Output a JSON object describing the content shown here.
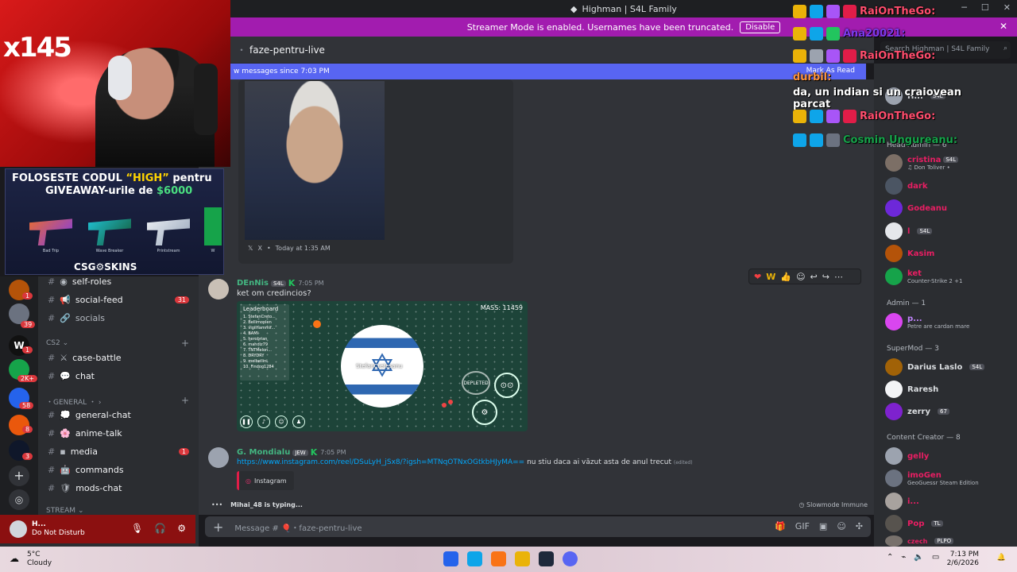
{
  "window": {
    "title": "Highman | S4L Family",
    "streamer_notice": "Streamer Mode is enabled. Usernames have been truncated.",
    "disable_label": "Disable"
  },
  "channel": {
    "name": "faze-pentru-live",
    "search_placeholder": "Search Highman | S4L Family",
    "new_messages": "w messages since 7:03 PM",
    "mark_as_read": "Mark As Read"
  },
  "messages": [
    {
      "embed_source": "X",
      "embed_time": "Today at 1:35 AM"
    },
    {
      "author": "DEnNis",
      "tag": "S4L",
      "time": "7:05 PM",
      "text": "ket om credincios?",
      "game": {
        "leaderboard_title": "Leaderboard",
        "leaderboard": [
          "1. StefanCreto...",
          "2. Bellimoplen",
          "3. vigilhammif...",
          "4. BAMI",
          "5. herobrian",
          "6. mahdiz79",
          "7. TNTMelon...",
          "8. DRYDRY",
          "9. melbellini",
          "10. Findog1284"
        ],
        "mass": "MASS: 11459",
        "player_label": "StefanCretesanu",
        "depleted": "DEPLETED"
      }
    },
    {
      "author": "G. Mondialu",
      "tag": "JEW",
      "time": "7:05 PM",
      "link": "https://www.instagram.com/reel/DSuLyH_jSx8/?igsh=MTNqOTNxOGtkbHJyMA==",
      "text": "nu stiu daca ai văzut asta de anul trecut",
      "edited": "(edited)",
      "embed": "Instagram"
    }
  ],
  "reactions": [
    "❤",
    "W",
    "👍",
    "☺",
    "↩",
    "↪",
    "⋯"
  ],
  "typing": "Mihai_48 is typing...",
  "slowmode": "Slowmode Immune",
  "composer_placeholder": "Message # 🎈・faze-pentru-live",
  "sidebar": {
    "channels": [
      {
        "name": "self-roles",
        "badge": ""
      },
      {
        "name": "social-feed",
        "badge": "31"
      },
      {
        "name": "socials",
        "badge": ""
      }
    ],
    "cat_cs2": "CS2",
    "cs2_channels": [
      {
        "name": "case-battle",
        "badge": ""
      },
      {
        "name": "chat",
        "badge": ""
      }
    ],
    "cat_general": "GENERAL",
    "general_channels": [
      {
        "name": "general-chat",
        "badge": ""
      },
      {
        "name": "anime-talk",
        "badge": ""
      },
      {
        "name": "media",
        "badge": "1"
      },
      {
        "name": "commands",
        "badge": ""
      },
      {
        "name": "mods-chat",
        "badge": ""
      }
    ],
    "cat_stream": "STREAM",
    "guild_badges": [
      "1",
      "39",
      "1",
      "2K+",
      "58",
      "8",
      "3"
    ]
  },
  "user": {
    "name": "H...",
    "status": "Do Not Disturb"
  },
  "members": {
    "groups": [
      {
        "label": "Head Admin — 6"
      },
      {
        "label": "Admin — 1"
      },
      {
        "label": "SuperMod — 3"
      },
      {
        "label": "Content Creator — 8"
      }
    ],
    "head_admin": [
      {
        "name": "H...",
        "tag": "S4L",
        "sub": "",
        "color": "#f2f3f5"
      },
      {
        "name": "cristina",
        "tag": "S4L",
        "sub": "♫ Don Toliver •",
        "color": "#e91e63"
      },
      {
        "name": "dark",
        "tag": "",
        "sub": "",
        "color": "#e91e63"
      },
      {
        "name": "Godeanu",
        "tag": "",
        "sub": "",
        "color": "#e91e63"
      },
      {
        "name": "l",
        "tag": "S4L",
        "sub": "",
        "color": "#e91e63"
      },
      {
        "name": "Kasim",
        "tag": "",
        "sub": "",
        "color": "#e91e63"
      },
      {
        "name": "ket",
        "tag": "",
        "sub": "Counter-Strike 2 +1",
        "color": "#e91e63"
      }
    ],
    "admin": [
      {
        "name": "p...",
        "tag": "",
        "sub": "Petre are cardan mare",
        "color": "#c084fc"
      }
    ],
    "supermod": [
      {
        "name": "Darius Laslo",
        "tag": "S4L",
        "sub": "",
        "color": "#f2f3f5"
      },
      {
        "name": "Raresh",
        "tag": "",
        "sub": "",
        "color": "#f2f3f5"
      },
      {
        "name": "zerry",
        "tag": "67",
        "sub": "",
        "color": "#f2f3f5"
      }
    ],
    "creators": [
      {
        "name": "gelly",
        "tag": "",
        "sub": "",
        "color": "#e91e63"
      },
      {
        "name": "imoGen",
        "tag": "",
        "sub": "GeoGuessr Steam Edition",
        "color": "#e91e63"
      },
      {
        "name": "i...",
        "tag": "",
        "sub": "",
        "color": "#e91e63"
      },
      {
        "name": "Pop",
        "tag": "TL",
        "sub": "",
        "color": "#e91e63"
      },
      {
        "name": "czech",
        "tag": "PLPO",
        "sub": "",
        "color": "#e91e63"
      }
    ]
  },
  "overlay": {
    "webcam_count": "x145",
    "promo_line1_a": "FOLOSESTE CODUL",
    "promo_code": "“HIGH”",
    "promo_line1_b": "pentru",
    "promo_line2_a": "GIVEAWAY-urile de",
    "promo_amount": "$6000",
    "guns": [
      "Bad Trip",
      "Wave Breaker",
      "Printstream",
      "W"
    ],
    "brand": "CSG⚙SKINS",
    "chat": [
      {
        "user": "RaiOnTheGo:",
        "text": ""
      },
      {
        "user": "Ana20021:",
        "text": ""
      },
      {
        "user": "RaiOnTheGo:",
        "text": ""
      },
      {
        "user": "durbil:",
        "text": "da, un indian si un craiovean parcat"
      },
      {
        "user": "RaiOnTheGo:",
        "text": ""
      },
      {
        "user": "Cosmin Ungureanu:",
        "text": ""
      }
    ]
  },
  "taskbar": {
    "temp": "5°C",
    "weather": "Cloudy",
    "time": "7:13 PM",
    "date": "2/6/2026"
  },
  "colors": {
    "accent": "#5865f2",
    "streamer_bar": "#a21caf",
    "online": "#23a55a",
    "dnd": "#da373c"
  }
}
